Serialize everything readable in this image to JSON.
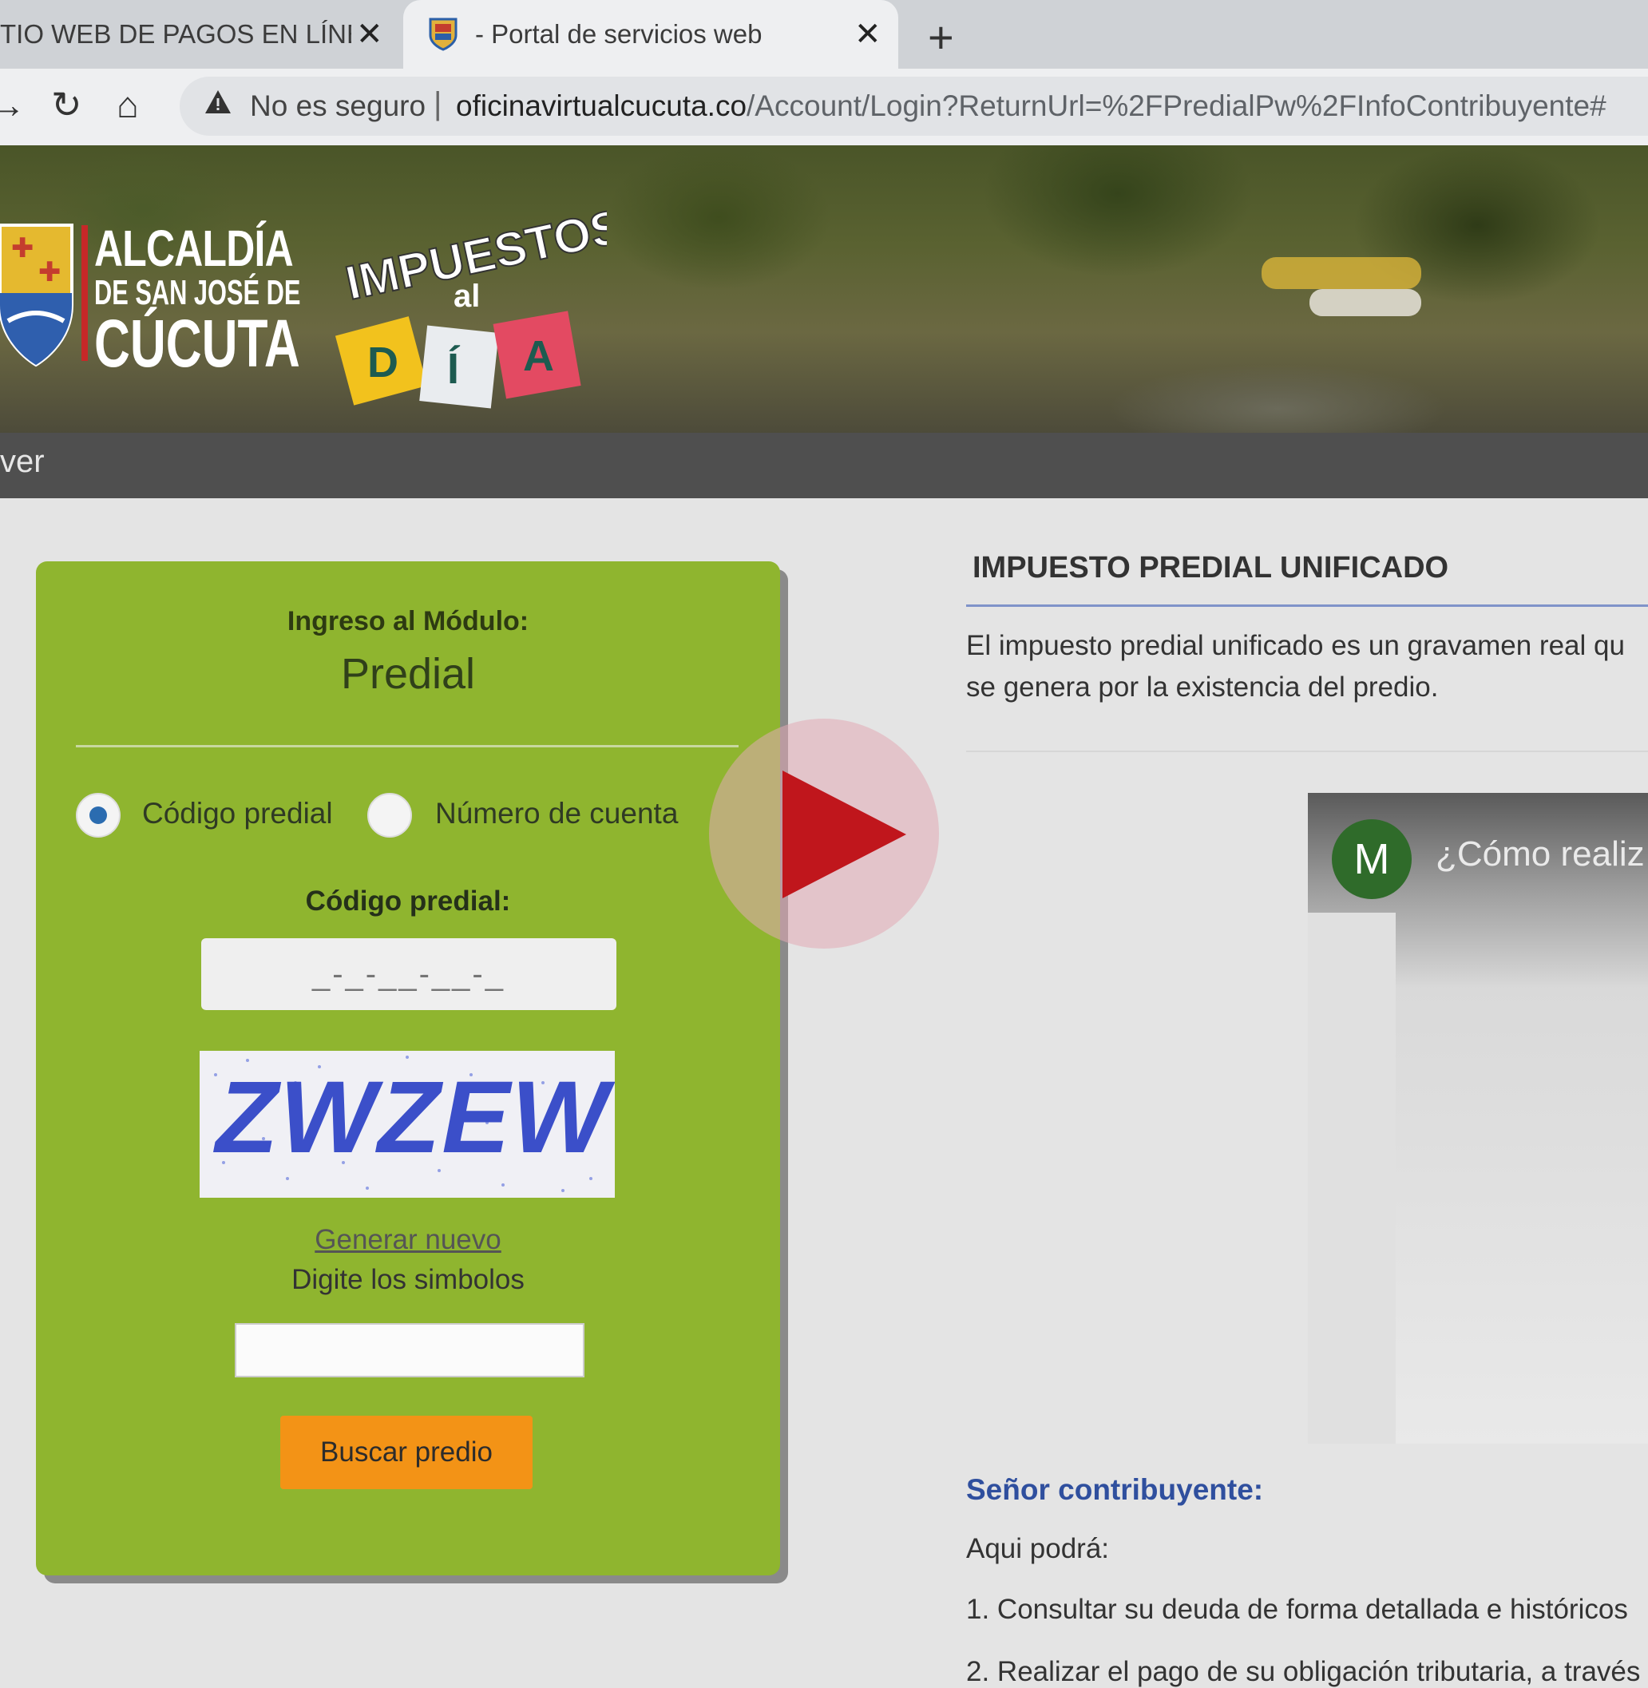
{
  "browser": {
    "tabs": [
      {
        "title": "TIO WEB DE PAGOS EN LÍNEA, ",
        "active": false,
        "close": "✕"
      },
      {
        "title": "- Portal de servicios web",
        "active": true,
        "close": "✕"
      }
    ],
    "new_tab": "+",
    "nav": {
      "forward": "→",
      "reload": "↻",
      "home": "⌂"
    },
    "security_label": "No es seguro",
    "separator": "|",
    "url_host": "oficinavirtualcucuta.co",
    "url_path": "/Account/Login?ReturnUrl=%2FPredialPw%2FInfoContribuyente#"
  },
  "banner": {
    "alcaldia_line1": "ALCALDÍA",
    "alcaldia_line2": "DE SAN JOSÉ DE",
    "alcaldia_line3": "CÚCUTA",
    "campaign_title": "IMPUESTOS",
    "campaign_al": "al",
    "campaign_letters": [
      "D",
      "Í",
      "A"
    ]
  },
  "nav_strip": {
    "partial_item": "ver"
  },
  "login": {
    "heading": "Ingreso al Módulo:",
    "module": "Predial",
    "options": [
      {
        "label": "Código predial",
        "selected": true
      },
      {
        "label": "Número de cuenta",
        "selected": false
      }
    ],
    "field_label": "Código predial:",
    "code_mask": "_-_-__-__-_",
    "captcha_text": "ZWZEW",
    "regenerate_link": "Generar nuevo",
    "symbols_prompt": "Digite los simbolos",
    "symbols_value": "",
    "submit": "Buscar predio"
  },
  "info": {
    "title": "IMPUESTO PREDIAL UNIFICADO",
    "desc_line1": "El impuesto predial unificado es un gravamen real qu",
    "desc_line2": "se genera por la existencia del predio.",
    "video": {
      "avatar_letter": "M",
      "title": "¿Cómo realiz"
    },
    "contribuyente": "Señor contribuyente:",
    "aqui": "Aqui podrá:",
    "item1": "1. Consultar su deuda de forma detallada e históricos",
    "item2": "2. Realizar el pago de su obligación tributaria, a través"
  },
  "colors": {
    "card_green": "#8fb52f",
    "button_orange": "#f39316",
    "dark_strip": "#4f4f4f",
    "play_red": "#c0161c",
    "link_blue": "#2f4f9e"
  }
}
